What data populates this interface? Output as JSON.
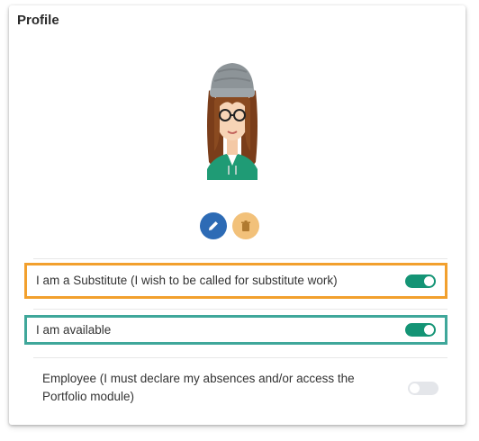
{
  "profile": {
    "title": "Profile",
    "avatar": {
      "icon": "avatar-illustration"
    },
    "actions": {
      "edit_icon": "pencil-icon",
      "edit_color": "#2d6bb5",
      "delete_icon": "trash-icon",
      "delete_color": "#f2c17a"
    },
    "settings": [
      {
        "label": "I am a Substitute (I wish to be called for substitute work)",
        "enabled": true,
        "highlight": "#f2a02d"
      },
      {
        "label": "I am available",
        "enabled": true,
        "highlight": "#3fa79a"
      },
      {
        "label": "Employee (I must declare my absences and/or access the Portfolio module)",
        "enabled": false
      }
    ],
    "colors": {
      "toggle_on": "#149475",
      "toggle_off": "#e4e6ea"
    }
  }
}
